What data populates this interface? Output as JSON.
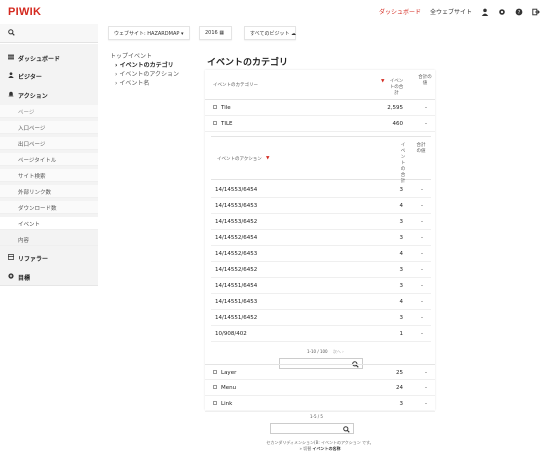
{
  "header": {
    "logo": "PIWIK",
    "dashboard_link": "ダッシュボード",
    "all_sites_link": "全ウェブサイト"
  },
  "selectors": {
    "site": "ウェブサイト: HAZARDMAP",
    "period": "2016",
    "segment": "すべてのビジット"
  },
  "sidebar": {
    "dashboard": "ダッシュボード",
    "visitors": "ビジター",
    "actions": "アクション",
    "action_items": [
      "ページ",
      "入口ページ",
      "出口ページ",
      "ページタイトル",
      "サイト検索",
      "外部リンク数",
      "ダウンロード数",
      "イベント",
      "内容"
    ],
    "referrers": "リファラー",
    "goals": "目標"
  },
  "subcategories": {
    "title": "トップイベント",
    "items": [
      "イベントのカテゴリ",
      "イベントのアクション",
      "イベント名"
    ]
  },
  "report": {
    "title": "イベントのカテゴリ",
    "col_label": "イベントのカテゴリー",
    "col_total": "イベントの合計",
    "col_value": "合計の値",
    "top_rows": [
      {
        "label": "Tile",
        "total": "2,595",
        "value": "-"
      },
      {
        "label": "TILE",
        "total": "460",
        "value": "-"
      }
    ],
    "sub": {
      "col_label": "イベントのアクション",
      "col_total": "イベントの合計",
      "col_value": "合計の値",
      "rows": [
        {
          "label": "14/14553/6454",
          "total": "3",
          "value": "-"
        },
        {
          "label": "14/14553/6453",
          "total": "4",
          "value": "-"
        },
        {
          "label": "14/14553/6452",
          "total": "3",
          "value": "-"
        },
        {
          "label": "14/14552/6454",
          "total": "3",
          "value": "-"
        },
        {
          "label": "14/14552/6453",
          "total": "4",
          "value": "-"
        },
        {
          "label": "14/14552/6452",
          "total": "3",
          "value": "-"
        },
        {
          "label": "14/14551/6454",
          "total": "3",
          "value": "-"
        },
        {
          "label": "14/14551/6453",
          "total": "4",
          "value": "-"
        },
        {
          "label": "14/14551/6452",
          "total": "3",
          "value": "-"
        },
        {
          "label": "10/908/402",
          "total": "1",
          "value": "-"
        }
      ],
      "pager": "1-10 / 100",
      "pager_next": "次へ ›"
    },
    "bottom_rows": [
      {
        "label": "Layer",
        "total": "25",
        "value": "-"
      },
      {
        "label": "Menu",
        "total": "24",
        "value": "-"
      },
      {
        "label": "Link",
        "total": "3",
        "value": "-"
      }
    ],
    "pager": "1-5 / 5",
    "footer_line1": "セカンダリディメンション(B: イベントのアクション です。",
    "footer_line2_prefix": "» 切替",
    "footer_line2_link": "イベントの名称"
  },
  "colors": {
    "brand": "#d4291f"
  }
}
